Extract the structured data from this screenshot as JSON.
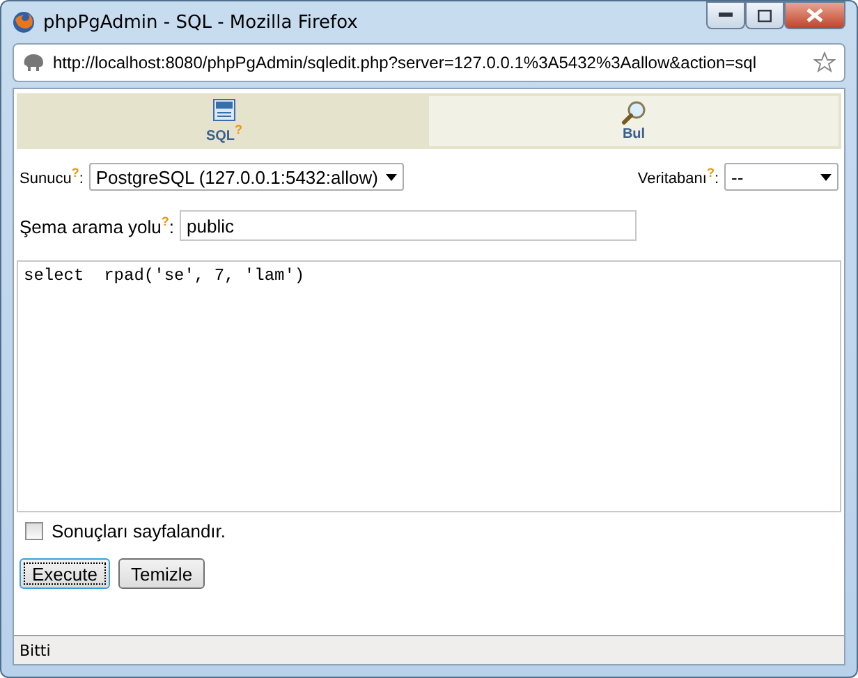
{
  "window": {
    "title": "phpPgAdmin - SQL - Mozilla Firefox"
  },
  "address_bar": {
    "url": "http://localhost:8080/phpPgAdmin/sqledit.php?server=127.0.0.1%3A5432%3Aallow&action=sql"
  },
  "tabs": [
    {
      "label": "SQL",
      "help": "?",
      "kind": "sql",
      "selected": true
    },
    {
      "label": "Bul",
      "kind": "find",
      "selected": false
    }
  ],
  "server": {
    "label": "Sunucu",
    "help": "?",
    "colon": ":",
    "value": "PostgreSQL (127.0.0.1:5432:allow)"
  },
  "database": {
    "label": "Veritabanı",
    "help": "?",
    "colon": ":",
    "value": "--"
  },
  "schema_path": {
    "label": "Şema arama yolu",
    "help": "?",
    "colon": ":",
    "value": "public"
  },
  "query": "select  rpad('se', 7, 'lam')",
  "paginate": {
    "label": "Sonuçları sayfalandır.",
    "checked": false
  },
  "buttons": [
    {
      "label": "Execute",
      "focused": true
    },
    {
      "label": "Temizle",
      "focused": false
    }
  ],
  "status_bar": "Bitti"
}
